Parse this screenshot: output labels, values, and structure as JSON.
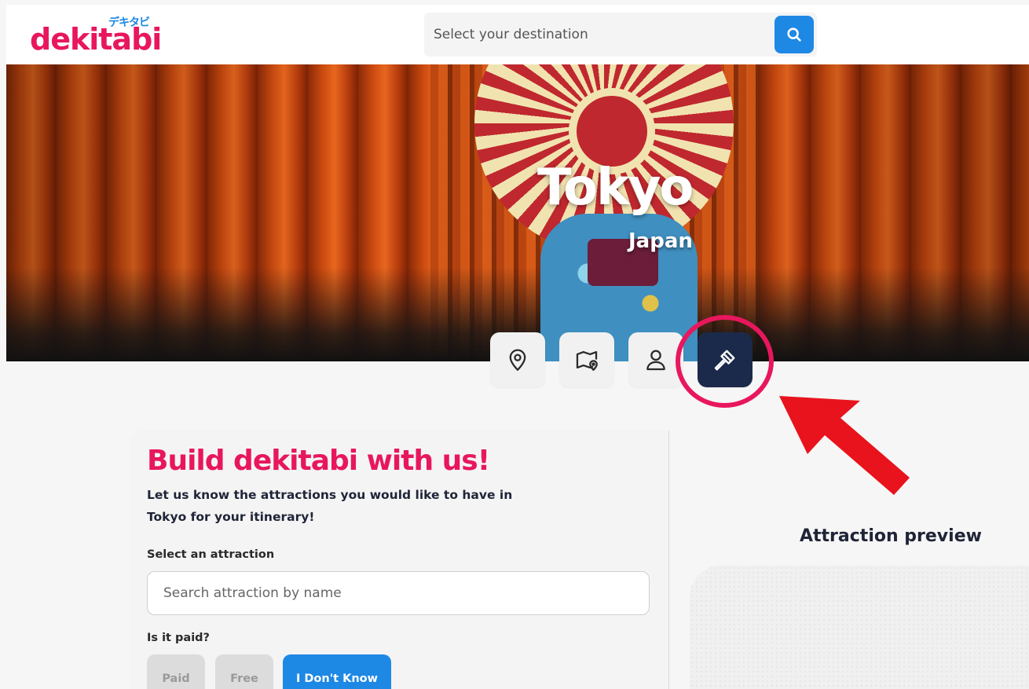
{
  "header": {
    "logo_text": "dekitabi",
    "logo_kana": "デキタビ",
    "search_placeholder": "Select your destination"
  },
  "hero": {
    "city": "Tokyo",
    "country": "Japan"
  },
  "tabs": [
    {
      "icon": "location-pin-icon",
      "active": false
    },
    {
      "icon": "map-icon",
      "active": false
    },
    {
      "icon": "user-icon",
      "active": false
    },
    {
      "icon": "hammer-icon",
      "active": true
    }
  ],
  "form": {
    "title": "Build dekitabi with us!",
    "description": "Let us know the attractions you would like to have in Tokyo for your itinerary!",
    "attraction_label": "Select an attraction",
    "attraction_placeholder": "Search attraction by name",
    "paid_label": "Is it paid?",
    "paid_options": [
      "Paid",
      "Free",
      "I Don't Know"
    ],
    "paid_selected": "I Don't Know"
  },
  "preview": {
    "title": "Attraction preview"
  },
  "colors": {
    "brand_pink": "#e8175d",
    "brand_blue": "#1e88e5",
    "navy": "#1b2a4a",
    "arrow_red": "#e8131c"
  }
}
